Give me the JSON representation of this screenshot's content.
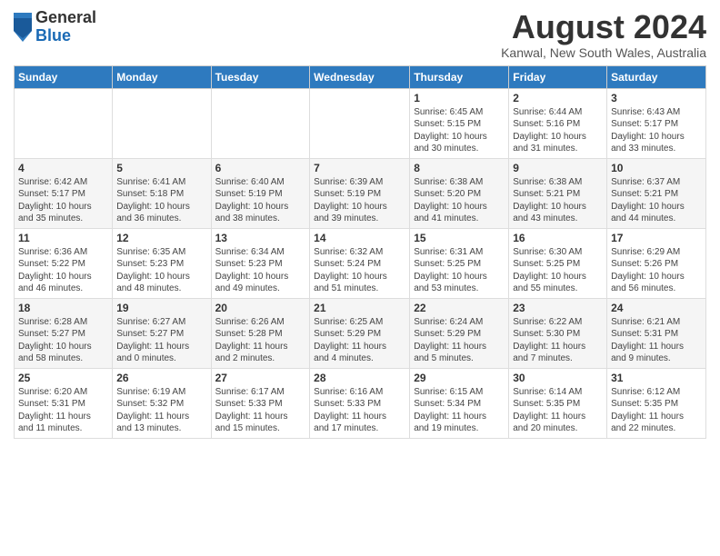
{
  "header": {
    "logo_general": "General",
    "logo_blue": "Blue",
    "month_year": "August 2024",
    "location": "Kanwal, New South Wales, Australia"
  },
  "weekdays": [
    "Sunday",
    "Monday",
    "Tuesday",
    "Wednesday",
    "Thursday",
    "Friday",
    "Saturday"
  ],
  "weeks": [
    [
      {
        "day": "",
        "info": ""
      },
      {
        "day": "",
        "info": ""
      },
      {
        "day": "",
        "info": ""
      },
      {
        "day": "",
        "info": ""
      },
      {
        "day": "1",
        "info": "Sunrise: 6:45 AM\nSunset: 5:15 PM\nDaylight: 10 hours\nand 30 minutes."
      },
      {
        "day": "2",
        "info": "Sunrise: 6:44 AM\nSunset: 5:16 PM\nDaylight: 10 hours\nand 31 minutes."
      },
      {
        "day": "3",
        "info": "Sunrise: 6:43 AM\nSunset: 5:17 PM\nDaylight: 10 hours\nand 33 minutes."
      }
    ],
    [
      {
        "day": "4",
        "info": "Sunrise: 6:42 AM\nSunset: 5:17 PM\nDaylight: 10 hours\nand 35 minutes."
      },
      {
        "day": "5",
        "info": "Sunrise: 6:41 AM\nSunset: 5:18 PM\nDaylight: 10 hours\nand 36 minutes."
      },
      {
        "day": "6",
        "info": "Sunrise: 6:40 AM\nSunset: 5:19 PM\nDaylight: 10 hours\nand 38 minutes."
      },
      {
        "day": "7",
        "info": "Sunrise: 6:39 AM\nSunset: 5:19 PM\nDaylight: 10 hours\nand 39 minutes."
      },
      {
        "day": "8",
        "info": "Sunrise: 6:38 AM\nSunset: 5:20 PM\nDaylight: 10 hours\nand 41 minutes."
      },
      {
        "day": "9",
        "info": "Sunrise: 6:38 AM\nSunset: 5:21 PM\nDaylight: 10 hours\nand 43 minutes."
      },
      {
        "day": "10",
        "info": "Sunrise: 6:37 AM\nSunset: 5:21 PM\nDaylight: 10 hours\nand 44 minutes."
      }
    ],
    [
      {
        "day": "11",
        "info": "Sunrise: 6:36 AM\nSunset: 5:22 PM\nDaylight: 10 hours\nand 46 minutes."
      },
      {
        "day": "12",
        "info": "Sunrise: 6:35 AM\nSunset: 5:23 PM\nDaylight: 10 hours\nand 48 minutes."
      },
      {
        "day": "13",
        "info": "Sunrise: 6:34 AM\nSunset: 5:23 PM\nDaylight: 10 hours\nand 49 minutes."
      },
      {
        "day": "14",
        "info": "Sunrise: 6:32 AM\nSunset: 5:24 PM\nDaylight: 10 hours\nand 51 minutes."
      },
      {
        "day": "15",
        "info": "Sunrise: 6:31 AM\nSunset: 5:25 PM\nDaylight: 10 hours\nand 53 minutes."
      },
      {
        "day": "16",
        "info": "Sunrise: 6:30 AM\nSunset: 5:25 PM\nDaylight: 10 hours\nand 55 minutes."
      },
      {
        "day": "17",
        "info": "Sunrise: 6:29 AM\nSunset: 5:26 PM\nDaylight: 10 hours\nand 56 minutes."
      }
    ],
    [
      {
        "day": "18",
        "info": "Sunrise: 6:28 AM\nSunset: 5:27 PM\nDaylight: 10 hours\nand 58 minutes."
      },
      {
        "day": "19",
        "info": "Sunrise: 6:27 AM\nSunset: 5:27 PM\nDaylight: 11 hours\nand 0 minutes."
      },
      {
        "day": "20",
        "info": "Sunrise: 6:26 AM\nSunset: 5:28 PM\nDaylight: 11 hours\nand 2 minutes."
      },
      {
        "day": "21",
        "info": "Sunrise: 6:25 AM\nSunset: 5:29 PM\nDaylight: 11 hours\nand 4 minutes."
      },
      {
        "day": "22",
        "info": "Sunrise: 6:24 AM\nSunset: 5:29 PM\nDaylight: 11 hours\nand 5 minutes."
      },
      {
        "day": "23",
        "info": "Sunrise: 6:22 AM\nSunset: 5:30 PM\nDaylight: 11 hours\nand 7 minutes."
      },
      {
        "day": "24",
        "info": "Sunrise: 6:21 AM\nSunset: 5:31 PM\nDaylight: 11 hours\nand 9 minutes."
      }
    ],
    [
      {
        "day": "25",
        "info": "Sunrise: 6:20 AM\nSunset: 5:31 PM\nDaylight: 11 hours\nand 11 minutes."
      },
      {
        "day": "26",
        "info": "Sunrise: 6:19 AM\nSunset: 5:32 PM\nDaylight: 11 hours\nand 13 minutes."
      },
      {
        "day": "27",
        "info": "Sunrise: 6:17 AM\nSunset: 5:33 PM\nDaylight: 11 hours\nand 15 minutes."
      },
      {
        "day": "28",
        "info": "Sunrise: 6:16 AM\nSunset: 5:33 PM\nDaylight: 11 hours\nand 17 minutes."
      },
      {
        "day": "29",
        "info": "Sunrise: 6:15 AM\nSunset: 5:34 PM\nDaylight: 11 hours\nand 19 minutes."
      },
      {
        "day": "30",
        "info": "Sunrise: 6:14 AM\nSunset: 5:35 PM\nDaylight: 11 hours\nand 20 minutes."
      },
      {
        "day": "31",
        "info": "Sunrise: 6:12 AM\nSunset: 5:35 PM\nDaylight: 11 hours\nand 22 minutes."
      }
    ]
  ]
}
